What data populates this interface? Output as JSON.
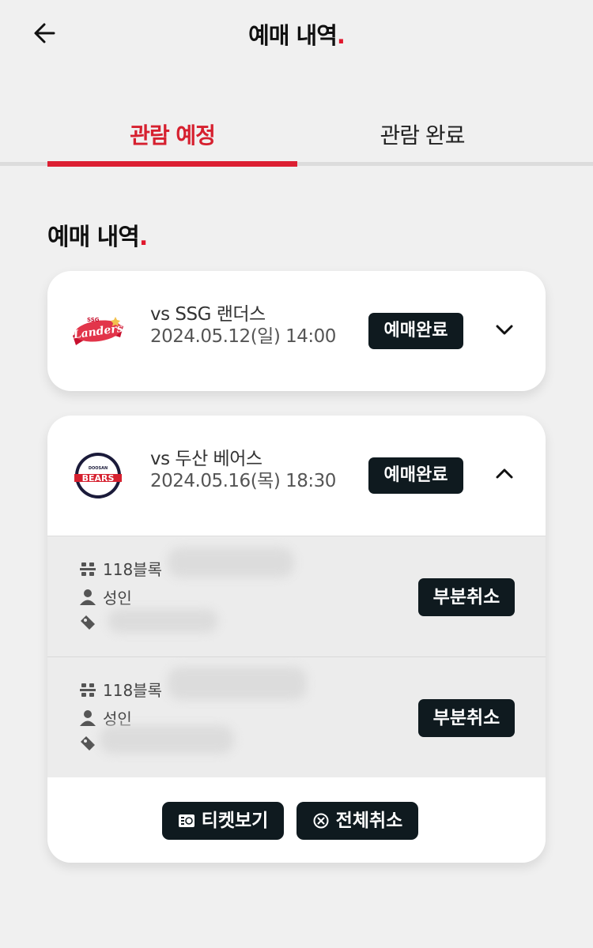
{
  "header": {
    "title": "예매 내역",
    "dot": "."
  },
  "tabs": [
    {
      "label": "관람 예정",
      "active": true
    },
    {
      "label": "관람 완료",
      "active": false
    }
  ],
  "section": {
    "title": "예매 내역",
    "dot": "."
  },
  "colors": {
    "accent": "#dc1f32",
    "button_dark": "#0f1a1f"
  },
  "reservations": [
    {
      "team_logo": "ssg-landers-logo",
      "opponent": "vs SSG 랜더스",
      "datetime": "2024.05.12(일) 14:00",
      "status": "예매완료",
      "expanded": false
    },
    {
      "team_logo": "doosan-bears-logo",
      "opponent": "vs 두산 베어스",
      "datetime": "2024.05.16(목) 18:30",
      "status": "예매완료",
      "expanded": true,
      "tickets": [
        {
          "block": "118블록",
          "type": "성인",
          "cancel_label": "부분취소"
        },
        {
          "block": "118블록",
          "type": "성인",
          "cancel_label": "부분취소"
        }
      ],
      "actions": {
        "view_ticket": "티켓보기",
        "cancel_all": "전체취소"
      }
    }
  ]
}
